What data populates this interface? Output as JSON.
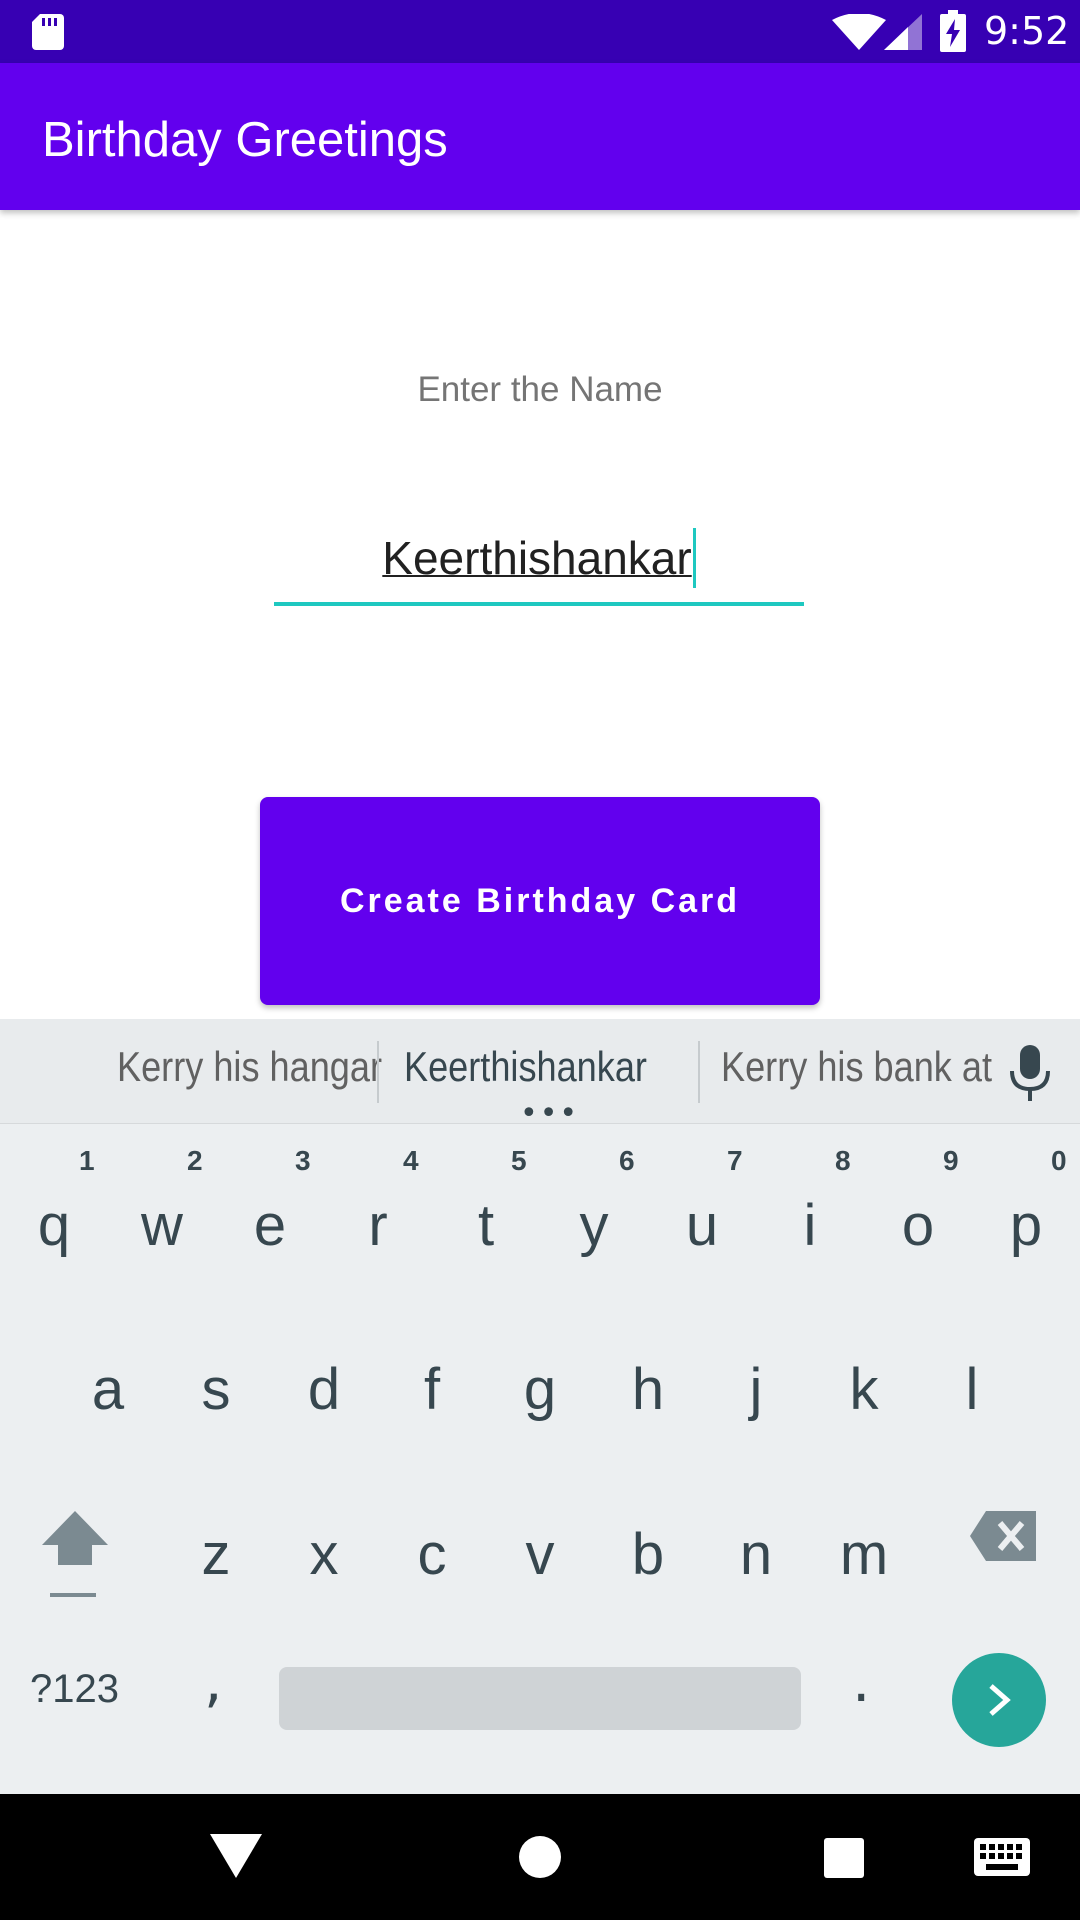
{
  "status_bar": {
    "time": "9:52"
  },
  "app_bar": {
    "title": "Birthday Greetings"
  },
  "form": {
    "label": "Enter the Name",
    "name_value": "Keerthishankar",
    "button_label": "Create Birthday Card"
  },
  "keyboard": {
    "suggestions": [
      "Kerry his hangar",
      "Keerthishankar",
      "Kerry his bank at"
    ],
    "row1": [
      "q",
      "w",
      "e",
      "r",
      "t",
      "y",
      "u",
      "i",
      "o",
      "p"
    ],
    "row1_hints": [
      "1",
      "2",
      "3",
      "4",
      "5",
      "6",
      "7",
      "8",
      "9",
      "0"
    ],
    "row2": [
      "a",
      "s",
      "d",
      "f",
      "g",
      "h",
      "j",
      "k",
      "l"
    ],
    "row3": [
      "z",
      "x",
      "c",
      "v",
      "b",
      "n",
      "m"
    ],
    "symbols_label": "?123",
    "comma": ",",
    "period": "."
  },
  "colors": {
    "status_bar": "#3700b3",
    "primary": "#6200ee",
    "accent": "#1ec8c0",
    "enter_key": "#26a69a"
  }
}
